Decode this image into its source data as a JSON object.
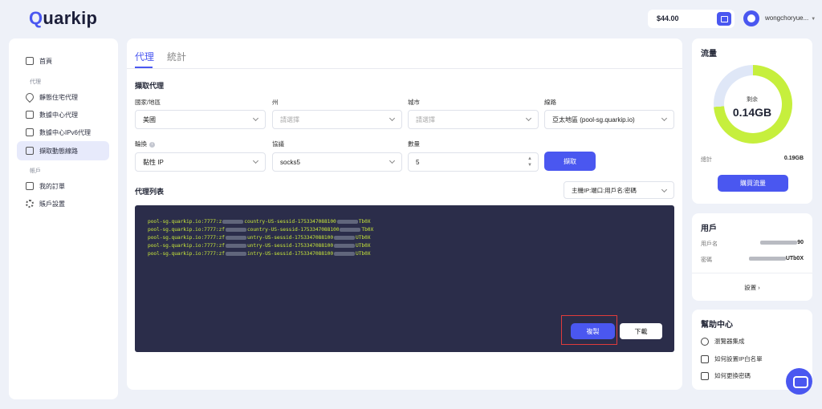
{
  "header": {
    "logo_text": "Quarkip",
    "balance": "$44.00",
    "username": "wongchoryue..."
  },
  "sidebar": {
    "home": "首頁",
    "section_proxy": "代理",
    "items": [
      "靜態住宅代理",
      "數據中心代理",
      "數據中心IPv6代理",
      "擷取動態線路"
    ],
    "section_account": "帳戶",
    "account_items": [
      "我的訂單",
      "賬戶設置"
    ]
  },
  "main": {
    "tabs": [
      "代理",
      "統計"
    ],
    "section_title": "擷取代理",
    "fields": {
      "country_label": "國家/地區",
      "country_value": "美國",
      "state_label": "州",
      "state_placeholder": "請選擇",
      "city_label": "城市",
      "city_placeholder": "請選擇",
      "line_label": "線路",
      "line_value": "亞太地區 (pool-sg.quarkip.io)",
      "rotation_label": "輪換",
      "rotation_value": "黏性 IP",
      "protocol_label": "協議",
      "protocol_value": "socks5",
      "quantity_label": "數量",
      "quantity_value": "5"
    },
    "fetch_button": "擷取",
    "list_title": "代理列表",
    "format_select": "主機IP:端口:用戶名:密碼",
    "proxy_lines": [
      {
        "pre": "pool-sg.quarkip.io:7777:z",
        "mid": "country-US-sessid-1753347088100",
        "post": "Tb0X"
      },
      {
        "pre": "pool-sg.quarkip.io:7777:zf",
        "mid": "country-US-sessid-1753347088100",
        "post": "Tb0X"
      },
      {
        "pre": "pool-sg.quarkip.io:7777:zf",
        "mid": "untry-US-sessid-1753347088100",
        "post": "UTb0X"
      },
      {
        "pre": "pool-sg.quarkip.io:7777:zf",
        "mid": "untry-US-sessid-1753347088100",
        "post": "UTb0X"
      },
      {
        "pre": "pool-sg.quarkip.io:7777:zf",
        "mid": "intry-US-sessid-1753347088100",
        "post": "UTb0X"
      }
    ],
    "copy_button": "複製",
    "download_button": "下載"
  },
  "traffic": {
    "title": "流量",
    "remaining_label": "剩余",
    "remaining_value": "0.14GB",
    "remaining_fraction": 0.74,
    "total_label": "總計",
    "total_value": "0.19GB",
    "buy_button": "購買流量"
  },
  "user": {
    "title": "用戶",
    "username_label": "用戶名",
    "username_value": "90",
    "password_label": "密碼",
    "password_value": "UTb0X",
    "settings_link": "設置"
  },
  "help": {
    "title": "幫助中心",
    "items": [
      "瀏覽器集成",
      "如何設置IP白名單",
      "如何更換密碼"
    ]
  },
  "colors": {
    "accent": "#4a57f0",
    "console_bg": "#2b2d4a",
    "proxy_text": "#c8e63a",
    "ring_fill": "#c6ef3d"
  }
}
